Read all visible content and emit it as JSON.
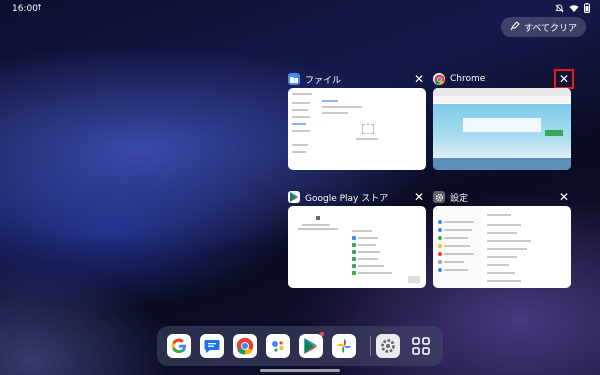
{
  "status_bar": {
    "time": "16:00",
    "upload_icon": "upload-arrow-icon",
    "icons": [
      "notifications-off-icon",
      "wifi-icon",
      "battery-icon"
    ]
  },
  "clear_all_label": "すべてクリア",
  "recents": [
    {
      "app": "ファイル",
      "icon": "files-folder-icon",
      "color": "#4a8af4"
    },
    {
      "app": "Chrome",
      "icon": "chrome-icon",
      "color": "#db4437"
    },
    {
      "app": "Google Play ストア",
      "icon": "play-store-icon",
      "color": "#01875f"
    },
    {
      "app": "設定",
      "icon": "settings-gear-icon",
      "color": "#5f6368"
    }
  ],
  "dock": [
    {
      "name": "google-search",
      "icon": "google-g-icon"
    },
    {
      "name": "messages",
      "icon": "messages-icon"
    },
    {
      "name": "chrome",
      "icon": "chrome-icon"
    },
    {
      "name": "assistant",
      "icon": "assistant-icon"
    },
    {
      "name": "play-store",
      "icon": "play-store-icon"
    },
    {
      "name": "photos",
      "icon": "photos-icon"
    },
    {
      "name": "settings",
      "icon": "settings-gear-icon"
    },
    {
      "name": "app-drawer",
      "icon": "app-grid-icon"
    }
  ]
}
